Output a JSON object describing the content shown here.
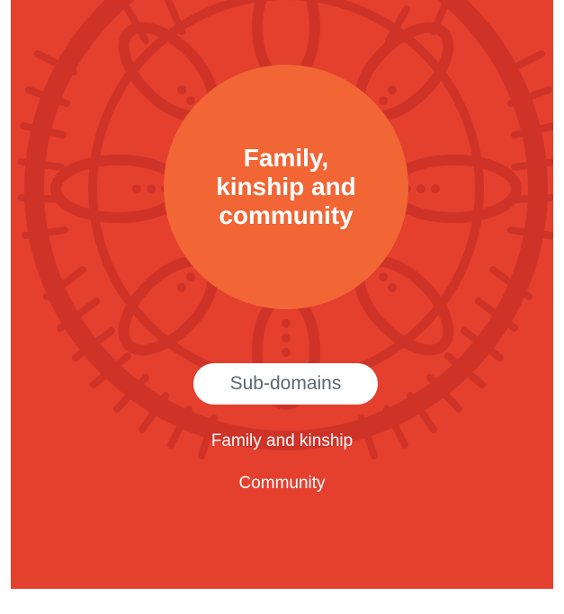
{
  "colors": {
    "background": "#e53f2e",
    "circle": "#f26535",
    "pattern": "#c9302a",
    "pill_text": "#5a6672"
  },
  "domain": {
    "title": "Family,\nkinship and\ncommunity"
  },
  "subdomains": {
    "label": "Sub-domains",
    "items": [
      "Family and kinship",
      "Community"
    ]
  },
  "decoration": {
    "pattern_icon": "aboriginal-dot-art-pattern"
  }
}
